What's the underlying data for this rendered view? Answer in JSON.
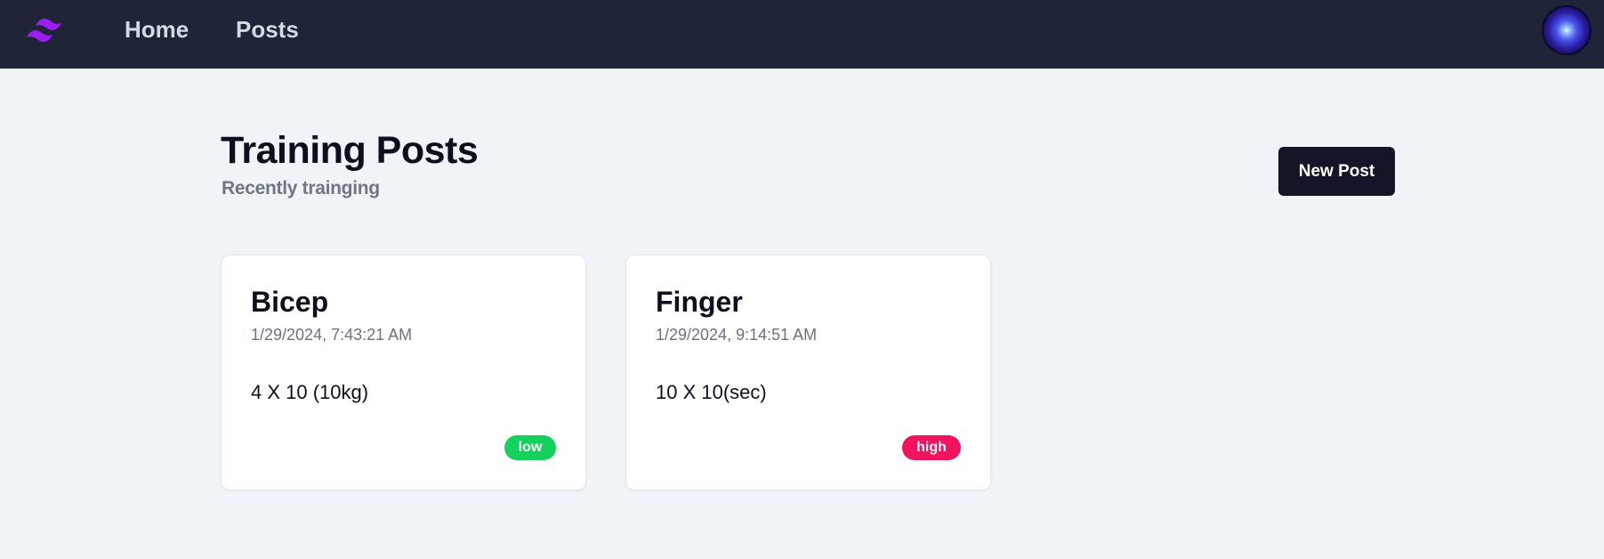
{
  "nav": {
    "logo_icon": "tailwind-wave-logo",
    "links": [
      {
        "label": "Home"
      },
      {
        "label": "Posts"
      }
    ],
    "avatar_icon": "user-avatar"
  },
  "header": {
    "title": "Training Posts",
    "subtitle": "Recently trainging",
    "new_post_label": "New Post"
  },
  "posts": [
    {
      "title": "Bicep",
      "date": "1/29/2024, 7:43:21 AM",
      "body": "4 X 10 (10kg)",
      "intensity": "low",
      "intensity_color": "#13d15c"
    },
    {
      "title": "Finger",
      "date": "1/29/2024, 9:14:51 AM",
      "body": "10 X 10(sec)",
      "intensity": "high",
      "intensity_color": "#f2125d"
    }
  ],
  "colors": {
    "navbar": "#1f2438",
    "background": "#f0f3f8",
    "button": "#141628",
    "logo": "#9b1df0"
  }
}
